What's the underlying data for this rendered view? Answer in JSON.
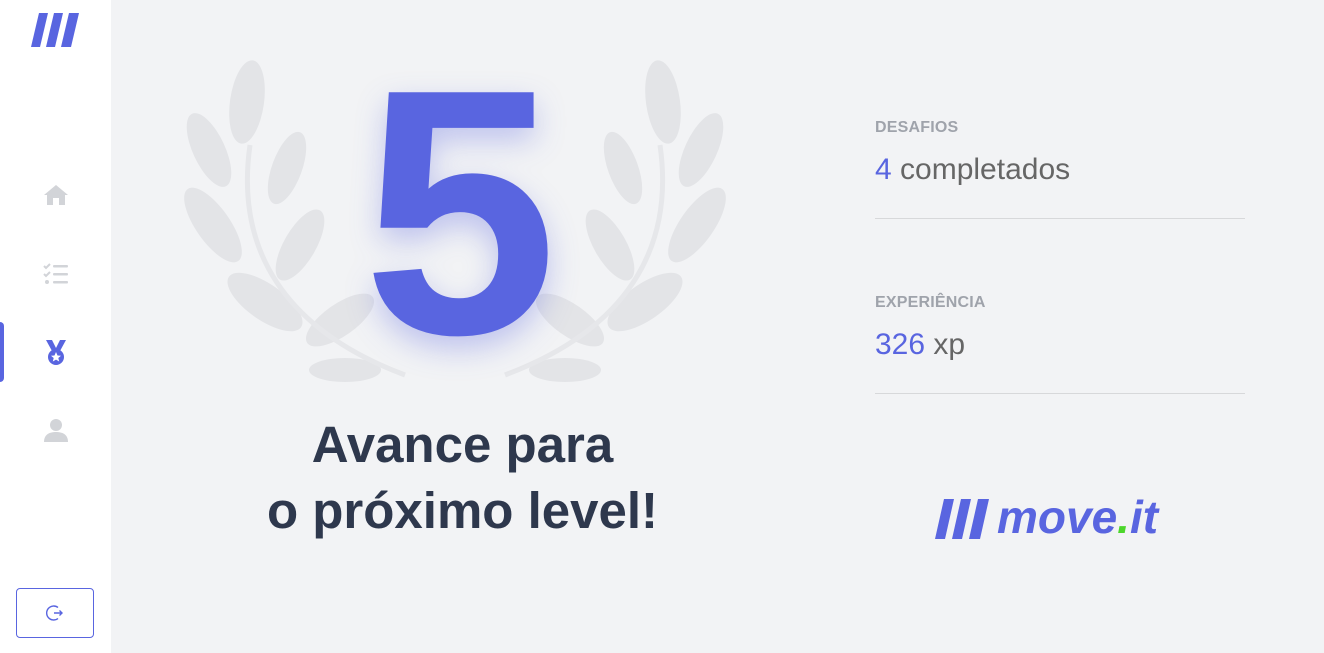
{
  "sidebar": {
    "logo_icon": "brand-bars-logo",
    "nav": [
      {
        "name": "home",
        "icon": "home-icon",
        "active": false
      },
      {
        "name": "challenges",
        "icon": "checklist-icon",
        "active": false
      },
      {
        "name": "leaderboard",
        "icon": "medal-icon",
        "active": true
      },
      {
        "name": "profile",
        "icon": "user-icon",
        "active": false
      }
    ],
    "logout_icon": "logout-icon"
  },
  "level_up": {
    "level": "5",
    "headline_line1": "Avance para",
    "headline_line2": "o próximo level!"
  },
  "stats": {
    "challenges": {
      "label": "DESAFIOS",
      "value": "4",
      "unit": "completados"
    },
    "experience": {
      "label": "EXPERIÊNCIA",
      "value": "326",
      "unit": "xp"
    }
  },
  "brand": {
    "name_part1": "move",
    "dot": ".",
    "name_part2": "it"
  },
  "colors": {
    "accent": "#5965e0",
    "background": "#f2f3f5",
    "headline": "#2e384d",
    "label": "#9fa3ab",
    "brand_dot": "#4cd62b"
  }
}
